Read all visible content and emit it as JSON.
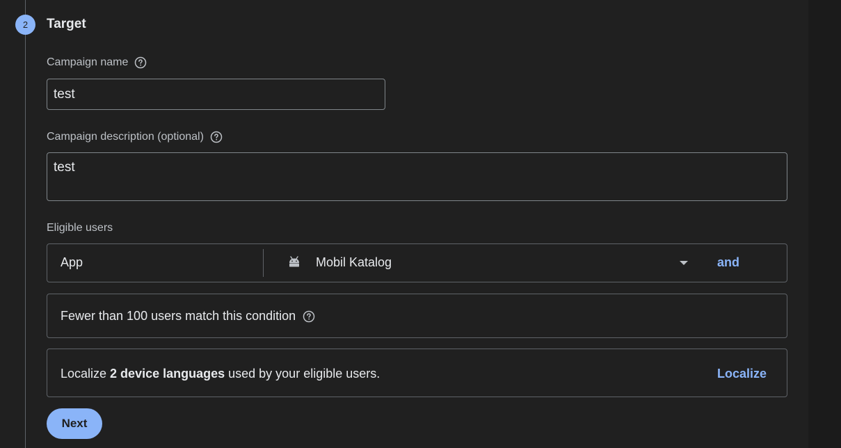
{
  "step": {
    "number": "2",
    "title": "Target"
  },
  "campaign_name": {
    "label": "Campaign name",
    "value": "test"
  },
  "campaign_description": {
    "label": "Campaign description (optional)",
    "value": "test"
  },
  "eligible_users": {
    "label": "Eligible users",
    "condition_type": "App",
    "app_icon": "android-icon",
    "app_name": "Mobil Katalog",
    "and_label": "and"
  },
  "match_info": {
    "text": "Fewer than 100 users match this condition"
  },
  "localize": {
    "prefix": "Localize ",
    "bold": "2 device languages",
    "suffix": " used by your eligible users.",
    "action_label": "Localize"
  },
  "next_label": "Next",
  "colors": {
    "background": "#202020",
    "accent": "#8ab4f8",
    "border": "#5f6368"
  }
}
